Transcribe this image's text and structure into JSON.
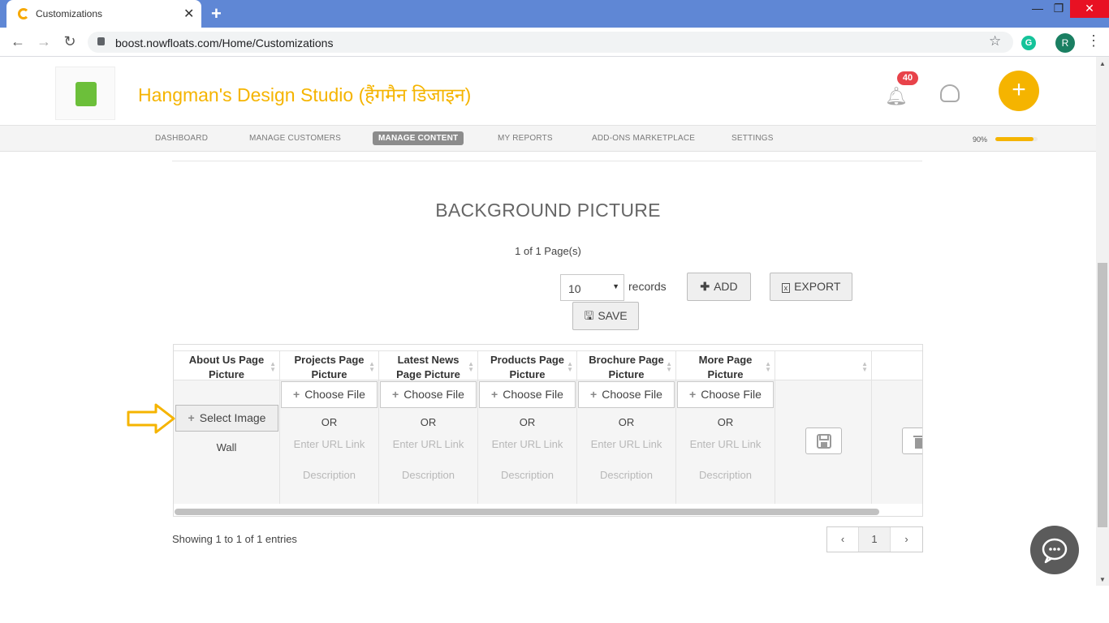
{
  "browser": {
    "tab_title": "Customizations",
    "tab_close": "✕",
    "new_tab": "+",
    "url": "boost.nowfloats.com/Home/Customizations",
    "profile_initial": "R",
    "ext_initial": "G",
    "window": {
      "minimize": "—",
      "restore": "❐",
      "close": "✕"
    }
  },
  "header": {
    "business_name": "Hangman's Design Studio (हैंगमैन डिजाइन)",
    "notification_count": "40",
    "fab_label": "+"
  },
  "nav": {
    "items": [
      "DASHBOARD",
      "MANAGE CUSTOMERS",
      "MANAGE CONTENT",
      "MY REPORTS",
      "ADD-ONS MARKETPLACE",
      "SETTINGS"
    ],
    "active": "MANAGE CONTENT",
    "progress_label": "90%",
    "progress_value": 0.9,
    "progress_color": "#f5b400"
  },
  "content": {
    "section_title": "BACKGROUND PICTURE",
    "pagination_info": "1 of 1 Page(s)",
    "records_value": "10",
    "records_label": "records",
    "add_label": "ADD",
    "export_label": "EXPORT",
    "save_label": "SAVE"
  },
  "table": {
    "headers": [
      [
        "About Us Page",
        "Picture"
      ],
      [
        "Projects Page",
        "Picture"
      ],
      [
        "Latest News",
        "Page Picture"
      ],
      [
        "Products Page",
        "Picture"
      ],
      [
        "Brochure Page",
        "Picture"
      ],
      [
        "More Page",
        "Picture"
      ]
    ],
    "row": {
      "select_image_label": "Select Image",
      "about_value": "Wall",
      "choose_file_label": "Choose File",
      "or_label": "OR",
      "url_placeholder": "Enter URL Link",
      "description_placeholder": "Description"
    },
    "footer_info": "Showing 1 to 1 of 1 entries",
    "pager": {
      "prev": "‹",
      "current": "1",
      "next": "›"
    }
  },
  "colors": {
    "accent": "#f5b400",
    "tabbar": "#5f87d5",
    "badge": "#e8434a"
  }
}
